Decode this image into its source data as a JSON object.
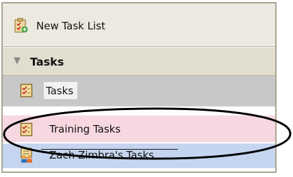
{
  "panel": {
    "new_task_label": "New Task List",
    "header_label": "Tasks",
    "items": [
      {
        "label": "Tasks",
        "icon": "task-list-icon"
      },
      {
        "label": "Training Tasks",
        "icon": "task-list-icon"
      },
      {
        "label": "Zach Zimbra's Tasks",
        "icon": "shared-task-list-icon"
      }
    ]
  },
  "colors": {
    "selected_row": "#c8c8c8",
    "pink_row": "#f8d8e0",
    "blue_row": "#c5d5ef",
    "header_bg": "#e1ddcf",
    "border": "#a8a391"
  }
}
